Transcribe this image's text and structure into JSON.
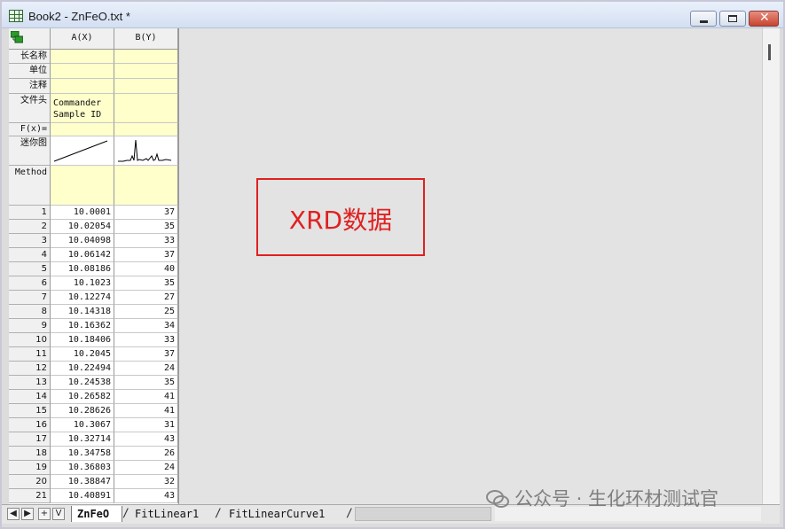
{
  "window": {
    "title": "Book2 - ZnFeO.txt *"
  },
  "columns": {
    "a": "A(X)",
    "b": "B(Y)"
  },
  "header_rows": {
    "long_name": "长名称",
    "unit": "单位",
    "comment": "注释",
    "file_header": "文件头",
    "file_header_a_line1": "Commander",
    "file_header_a_line2": "Sample ID",
    "fx": "F(x)=",
    "sparkline": "迷你图",
    "method": "Method"
  },
  "rows": [
    {
      "n": "1",
      "x": "10.0001",
      "y": "37"
    },
    {
      "n": "2",
      "x": "10.02054",
      "y": "35"
    },
    {
      "n": "3",
      "x": "10.04098",
      "y": "33"
    },
    {
      "n": "4",
      "x": "10.06142",
      "y": "37"
    },
    {
      "n": "5",
      "x": "10.08186",
      "y": "40"
    },
    {
      "n": "6",
      "x": "10.1023",
      "y": "35"
    },
    {
      "n": "7",
      "x": "10.12274",
      "y": "27"
    },
    {
      "n": "8",
      "x": "10.14318",
      "y": "25"
    },
    {
      "n": "9",
      "x": "10.16362",
      "y": "34"
    },
    {
      "n": "10",
      "x": "10.18406",
      "y": "33"
    },
    {
      "n": "11",
      "x": "10.2045",
      "y": "37"
    },
    {
      "n": "12",
      "x": "10.22494",
      "y": "24"
    },
    {
      "n": "13",
      "x": "10.24538",
      "y": "35"
    },
    {
      "n": "14",
      "x": "10.26582",
      "y": "41"
    },
    {
      "n": "15",
      "x": "10.28626",
      "y": "41"
    },
    {
      "n": "16",
      "x": "10.3067",
      "y": "31"
    },
    {
      "n": "17",
      "x": "10.32714",
      "y": "43"
    },
    {
      "n": "18",
      "x": "10.34758",
      "y": "26"
    },
    {
      "n": "19",
      "x": "10.36803",
      "y": "24"
    },
    {
      "n": "20",
      "x": "10.38847",
      "y": "32"
    },
    {
      "n": "21",
      "x": "10.40891",
      "y": "43"
    }
  ],
  "annotation": {
    "label": "XRD数据",
    "color": "#e02020"
  },
  "sheet_tabs": [
    {
      "label": "ZnFeO",
      "active": true
    },
    {
      "label": "FitLinear1",
      "active": false
    },
    {
      "label": "FitLinearCurve1",
      "active": false
    }
  ],
  "nav_buttons": [
    "◀",
    "▶",
    "+",
    "V"
  ],
  "watermark": "公众号 · 生化环材测试官",
  "icons": [
    "worksheet-icon",
    "minimize-icon",
    "maximize-icon",
    "close-icon",
    "column-props-icon"
  ]
}
